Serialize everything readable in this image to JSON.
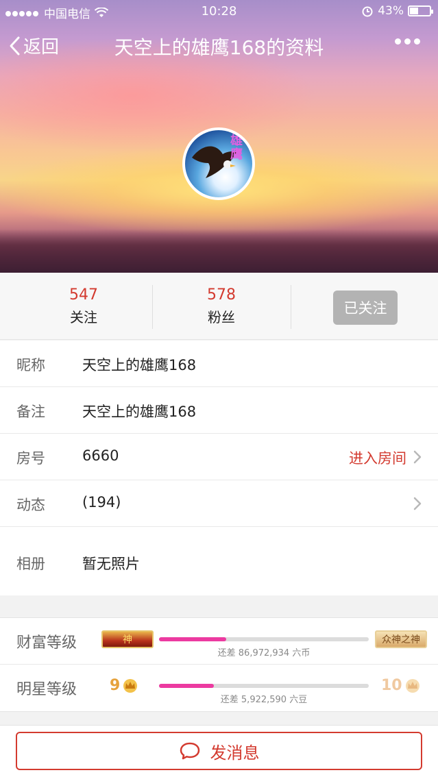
{
  "status_bar": {
    "carrier": "中国电信",
    "time": "10:28",
    "battery": "43%",
    "icons": [
      "signal-dots-icon",
      "wifi-icon",
      "alarm-icon",
      "battery-icon"
    ]
  },
  "nav": {
    "back_label": "返回",
    "title": "天空上的雄鹰168的资料",
    "more_icon": "more-dots-icon"
  },
  "profile": {
    "avatar_text": "雄鹰"
  },
  "stats": {
    "following_count": "547",
    "following_label": "关注",
    "fans_count": "578",
    "fans_label": "粉丝",
    "follow_button": "已关注"
  },
  "info": {
    "nickname_label": "昵称",
    "nickname_value": "天空上的雄鹰168",
    "remark_label": "备注",
    "remark_value": "天空上的雄鹰168",
    "room_label": "房号",
    "room_value": "6660",
    "room_action": "进入房间",
    "feed_label": "动态",
    "feed_value": "(194)",
    "album_label": "相册",
    "album_value": "暂无照片"
  },
  "levels": {
    "wealth_label": "财富等级",
    "wealth_current_badge": "神",
    "wealth_next_badge": "众神之神",
    "wealth_progress": 0.32,
    "wealth_caption": "还差 86,972,934 六币",
    "star_label": "明星等级",
    "star_current": "9",
    "star_next": "10",
    "star_progress": 0.26,
    "star_caption": "还差 5,922,590 六豆"
  },
  "bottom": {
    "send_label": "发消息",
    "send_icon": "chat-bubble-icon"
  },
  "colors": {
    "accent_red": "#d33a2f",
    "progress_pink": "#ec3aa0",
    "follow_gray": "#b3b3b3"
  }
}
